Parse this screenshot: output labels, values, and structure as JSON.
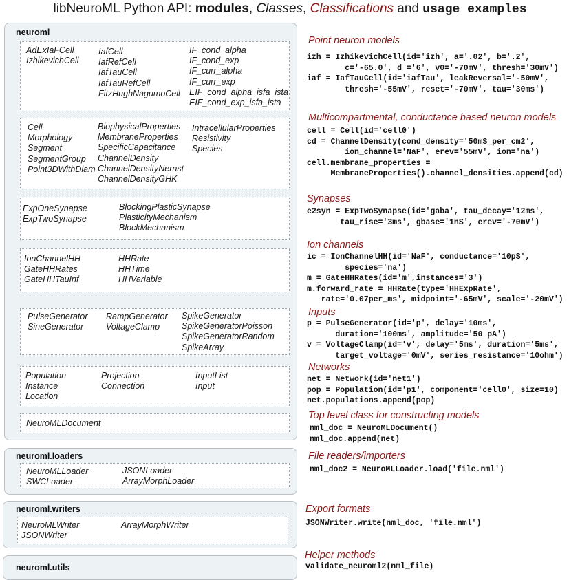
{
  "title": {
    "prefix": "libNeuroML Python API: ",
    "modules": "modules",
    "sep1": ", ",
    "classes": "Classes",
    "sep2": ", ",
    "classifications": "Classifications",
    "and": " and ",
    "usage": "usage examples"
  },
  "colors": {
    "classification": "#8b1a1a",
    "module_bg": "#edf2f5",
    "group_bg": "#ffffff"
  },
  "modules": {
    "neuroml": {
      "name": "neuroml",
      "groups": {
        "point_neurons": {
          "cols": [
            [
              "AdExIaFCell",
              "IzhikevichCell"
            ],
            [
              "IafCell",
              "IafRefCell",
              "IafTauCell",
              "IafTauRefCell",
              "FitzHughNagumoCell"
            ],
            [
              "IF_cond_alpha",
              "IF_cond_exp",
              "IF_curr_alpha",
              "IF_curr_exp",
              "EIF_cond_alpha_isfa_ista",
              "EIF_cond_exp_isfa_ista"
            ]
          ]
        },
        "multicompartmental": {
          "cols": [
            [
              "Cell",
              "Morphology",
              "Segment",
              "SegmentGroup",
              "Point3DWithDiam"
            ],
            [
              "BiophysicalProperties",
              "MembraneProperties",
              "SpecificCapacitance",
              "ChannelDensity",
              "ChannelDensityNernst",
              "ChannelDensityGHK"
            ],
            [
              "IntracellularProperties",
              "Resistivity",
              "Species"
            ]
          ]
        },
        "synapses": {
          "cols": [
            [
              "ExpOneSynapse",
              "ExpTwoSynapse"
            ],
            [
              "BlockingPlasticSynapse",
              "PlasticityMechanism",
              "BlockMechanism"
            ]
          ]
        },
        "ion_channels": {
          "cols": [
            [
              "IonChannelHH",
              "GateHHRates",
              "GateHHTauInf"
            ],
            [
              "HHRate",
              "HHTime",
              "HHVariable"
            ]
          ]
        },
        "inputs": {
          "cols": [
            [
              "PulseGenerator",
              "SineGenerator"
            ],
            [
              "RampGenerator",
              "VoltageClamp"
            ],
            [
              "SpikeGenerator",
              "SpikeGeneratorPoisson",
              "SpikeGeneratorRandom",
              "SpikeArray"
            ]
          ]
        },
        "networks": {
          "cols": [
            [
              "Population",
              "Instance",
              "Location"
            ],
            [
              "Projection",
              "Connection"
            ],
            [
              "InputList",
              "Input"
            ]
          ]
        },
        "top_level": {
          "cols": [
            [
              "NeuroMLDocument"
            ]
          ]
        }
      }
    },
    "loaders": {
      "name": "neuroml.loaders",
      "cols": [
        [
          "NeuroMLLoader",
          "SWCLoader"
        ],
        [
          "JSONLoader",
          "ArrayMorphLoader"
        ]
      ]
    },
    "writers": {
      "name": "neuroml.writers",
      "cols": [
        [
          "NeuroMLWriter",
          "JSONWriter"
        ],
        [
          "ArrayMorphWriter"
        ]
      ]
    },
    "utils": {
      "name": "neuroml.utils"
    }
  },
  "examples": [
    {
      "title": "Point neuron models",
      "code": "izh = IzhikevichCell(id='izh', a='.02', b='.2',\n        c='-65.0', d ='6', v0='-70mV', thresh='30mV')\niaf = IafTauCell(id='iafTau', leakReversal='-50mV',\n        thresh='-55mV', reset='-70mV', tau='30ms')"
    },
    {
      "title": "Multicompartmental, conductance based neuron models",
      "code": "cell = Cell(id='cell0')\ncd = ChannelDensity(cond_density='50mS_per_cm2',\n        ion_channel='NaF', erev='55mV', ion='na')\ncell.membrane_properties =\n     MembraneProperties().channel_densities.append(cd)"
    },
    {
      "title": "Synapses",
      "code": "e2syn = ExpTwoSynapse(id='gaba', tau_decay='12ms',\n       tau_rise='3ms', gbase='1nS', erev='-70mV')"
    },
    {
      "title": "Ion channels",
      "code": "ic = IonChannelHH(id='NaF', conductance='10pS',\n        species='na')\nm = GateHHRates(id='m',instances='3')\nm.forward_rate = HHRate(type='HHExpRate',\n   rate='0.07per_ms', midpoint='-65mV', scale='-20mV')"
    },
    {
      "title": "Inputs",
      "code": "p = PulseGenerator(id='p', delay='10ms',\n      duration='100ms', amplitude='50 pA')\nv = VoltageClamp(id='v', delay='5ms', duration='5ms',\n      target_voltage='0mV', series_resistance='10ohm')"
    },
    {
      "title": "Networks",
      "code": "net = Network(id='net1')\npop = Population(id='p1', component='cell0', size=10)\nnet.populations.append(pop)"
    },
    {
      "title": "Top level class for constructing models",
      "code": "nml_doc = NeuroMLDocument()\nnml_doc.append(net)"
    },
    {
      "title": "File readers/importers",
      "code": "nml_doc2 = NeuroMLLoader.load('file.nml')"
    },
    {
      "title": "Export formats",
      "code": "JSONWriter.write(nml_doc, 'file.nml')"
    },
    {
      "title": "Helper methods",
      "code": "validate_neuroml2(nml_file)"
    }
  ]
}
